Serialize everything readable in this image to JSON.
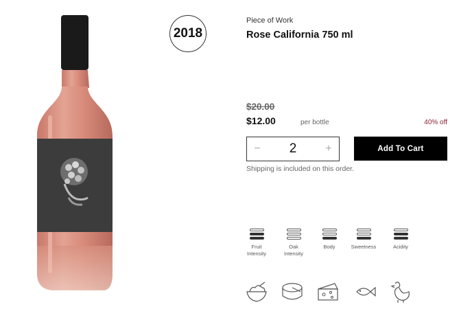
{
  "product": {
    "vintage": "2018",
    "winery": "Piece of Work",
    "title": "Rose California 750 ml",
    "original_price": "$20.00",
    "price": "$12.00",
    "unit": "per bottle",
    "discount": "40% off",
    "quantity": "2",
    "add_to_cart_label": "Add To Cart",
    "shipping_note": "Shipping is included on this order.",
    "qty_minus": "−",
    "qty_plus": "+"
  },
  "attributes": [
    {
      "line1": "Fruit",
      "line2": "Intensity",
      "level": 2
    },
    {
      "line1": "Oak",
      "line2": "Intensity",
      "level": 0
    },
    {
      "line1": "Body",
      "line2": "",
      "level": 1
    },
    {
      "line1": "Sweetness",
      "line2": "",
      "level": 1
    },
    {
      "line1": "Acidity",
      "line2": "",
      "level": 2
    }
  ],
  "pairings": [
    "salad-bowl-icon",
    "cheese-wheel-icon",
    "cheese-wedge-icon",
    "fish-icon",
    "chicken-icon"
  ],
  "colors": {
    "accent": "#000000",
    "discount": "#8a2131",
    "wine": "#d8907e",
    "label": "#3c3c3c"
  }
}
